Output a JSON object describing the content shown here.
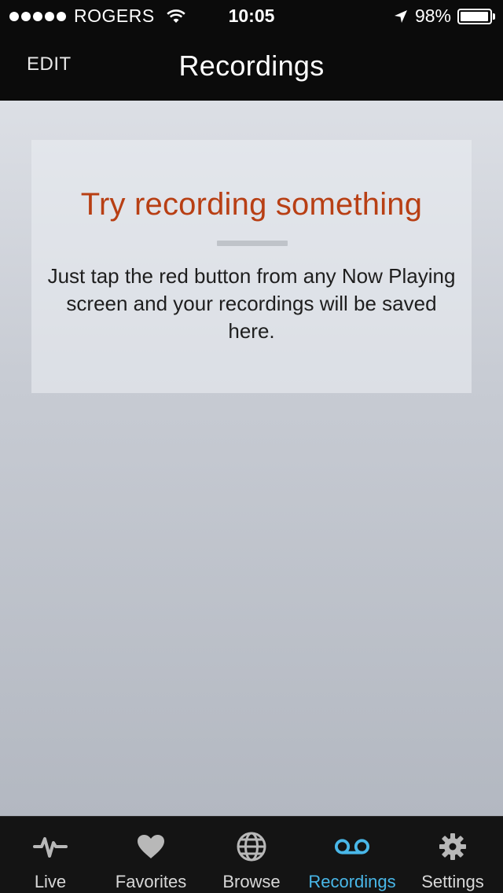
{
  "status_bar": {
    "carrier": "ROGERS",
    "time": "10:05",
    "battery": "98%",
    "battery_level": 0.98
  },
  "nav": {
    "edit_label": "EDIT",
    "title": "Recordings"
  },
  "empty_state": {
    "title": "Try recording something",
    "message": "Just tap the red button from any Now Playing screen and your recordings will be saved here."
  },
  "tabs": [
    {
      "label": "Live",
      "icon": "live-pulse-icon",
      "active": false
    },
    {
      "label": "Favorites",
      "icon": "heart-icon",
      "active": false
    },
    {
      "label": "Browse",
      "icon": "globe-icon",
      "active": false
    },
    {
      "label": "Recordings",
      "icon": "voicemail-icon",
      "active": true
    },
    {
      "label": "Settings",
      "icon": "gear-icon",
      "active": false
    }
  ],
  "colors": {
    "accent": "#49b7e8",
    "title_red": "#b83f14",
    "inactive_icon": "#b8b8b8"
  }
}
